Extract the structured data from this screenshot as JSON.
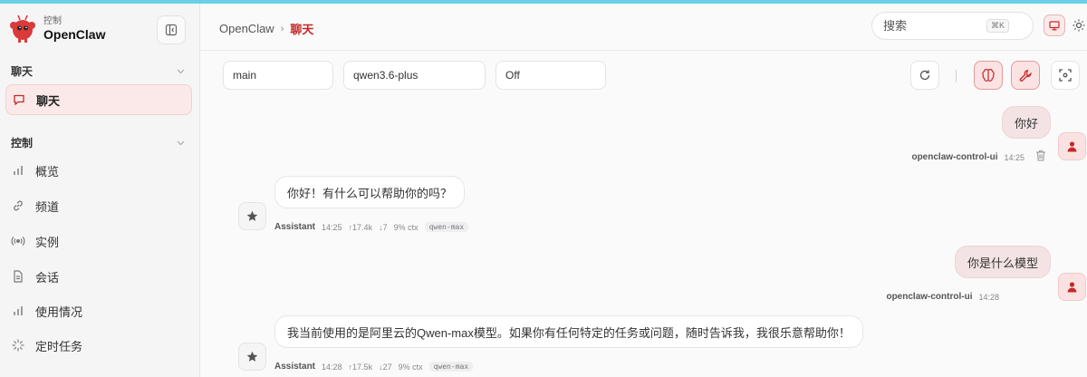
{
  "sidebar": {
    "brand": {
      "subtitle": "控制",
      "name": "OpenClaw"
    },
    "sections": [
      {
        "title": "聊天",
        "items": [
          {
            "label": "聊天",
            "icon": "chat-bubble-icon",
            "active": true
          }
        ]
      },
      {
        "title": "控制",
        "items": [
          {
            "label": "概览",
            "icon": "bar-chart-icon"
          },
          {
            "label": "频道",
            "icon": "link-icon"
          },
          {
            "label": "实例",
            "icon": "radio-waves-icon"
          },
          {
            "label": "会话",
            "icon": "document-icon"
          },
          {
            "label": "使用情况",
            "icon": "bar-chart-icon"
          },
          {
            "label": "定时任务",
            "icon": "loader-icon"
          }
        ]
      }
    ]
  },
  "header": {
    "breadcrumb": {
      "root": "OpenClaw",
      "separator": "›",
      "current": "聊天"
    },
    "search": {
      "placeholder": "搜索",
      "shortcut": "⌘K"
    }
  },
  "toolbar": {
    "session": "main",
    "model": "qwen3.6-plus",
    "thinking": "Off"
  },
  "messages": [
    {
      "role": "user",
      "text": "你好",
      "sender": "openclaw-control-ui",
      "time": "14:25"
    },
    {
      "role": "assistant",
      "text": "你好！有什么可以帮助你的吗？",
      "sender": "Assistant",
      "time": "14:25",
      "tokens_in": "↑17.4k",
      "tokens_out": "↓7",
      "ctx": "9% ctx",
      "model": "qwen-max"
    },
    {
      "role": "user",
      "text": "你是什么模型",
      "sender": "openclaw-control-ui",
      "time": "14:28"
    },
    {
      "role": "assistant",
      "text": "我当前使用的是阿里云的Qwen-max模型。如果你有任何特定的任务或问题，随时告诉我，我很乐意帮助你！",
      "sender": "Assistant",
      "time": "14:28",
      "tokens_in": "↑17.5k",
      "tokens_out": "↓27",
      "ctx": "9% ctx",
      "model": "qwen-max"
    }
  ],
  "colors": {
    "accent": "#c62828",
    "topline": "#6ad0e8",
    "active_bg": "#fbe9e9",
    "user_bubble": "#f3e3e4"
  }
}
